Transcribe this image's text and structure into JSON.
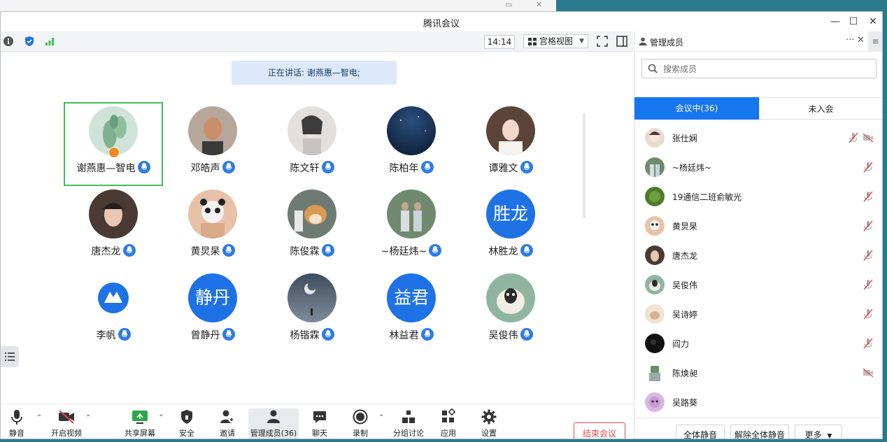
{
  "window": {
    "title": "腾讯会议"
  },
  "status_bar": {
    "time": "14:14",
    "view_label": "宫格视图"
  },
  "speaking_banner": "正在讲话: 谢燕惠—智电;",
  "participants": [
    {
      "name": "谢燕惠—智电",
      "active": true
    },
    {
      "name": "邓皓声"
    },
    {
      "name": "陈文轩"
    },
    {
      "name": "陈柏年"
    },
    {
      "name": "谭雅文"
    },
    {
      "name": "唐杰龙"
    },
    {
      "name": "黄炅杲"
    },
    {
      "name": "陈俊霖"
    },
    {
      "name": "~杨廷炜~"
    },
    {
      "name": "林胜龙",
      "avatar_text": "胜龙"
    },
    {
      "name": "李帆"
    },
    {
      "name": "曾静丹",
      "avatar_text": "静丹"
    },
    {
      "name": "杨锴霖"
    },
    {
      "name": "林益君",
      "avatar_text": "益君"
    },
    {
      "name": "吴俊伟"
    }
  ],
  "toolbar": {
    "mute": "静音",
    "video": "开启视频",
    "share": "共享屏幕",
    "security": "安全",
    "invite": "邀请",
    "members": "管理成员(36)",
    "chat": "聊天",
    "record": "录制",
    "breakout": "分组讨论",
    "apps": "应用",
    "settings": "设置",
    "end": "结束会议"
  },
  "panel": {
    "title": "管理成员",
    "search_placeholder": "搜索成员",
    "tab_in_meeting": "会议中(36)",
    "tab_not_joined": "未入会",
    "members": [
      {
        "name": "张仕娴"
      },
      {
        "name": "~杨廷炜~"
      },
      {
        "name": "19通信二班俞敏光"
      },
      {
        "name": "黄炅杲"
      },
      {
        "name": "唐杰龙"
      },
      {
        "name": "吴俊伟"
      },
      {
        "name": "吴诗婷"
      },
      {
        "name": "阎力"
      },
      {
        "name": "陈焕昶"
      },
      {
        "name": "吴路葵"
      }
    ],
    "mute_all": "全体静音",
    "unmute_all": "解除全体静音",
    "more": "更多"
  },
  "colors": {
    "accent": "#1676f0",
    "speaking": "#3fbf59",
    "end": "#e34a4a"
  }
}
